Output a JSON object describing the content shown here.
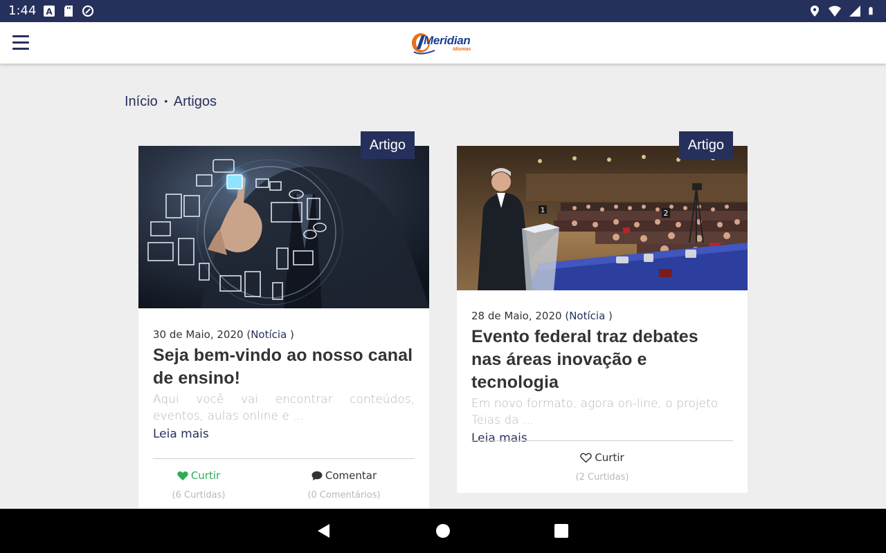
{
  "status_bar": {
    "time": "1:44",
    "left_icons": [
      "a-icon",
      "sd-card-icon",
      "sync-icon"
    ],
    "right_icons": [
      "location-icon",
      "wifi-icon",
      "signal-icon",
      "battery-icon"
    ]
  },
  "app_bar": {
    "menu_icon": "hamburger-menu-icon",
    "logo_text": "Meridian",
    "logo_subtext": "Idiomas"
  },
  "breadcrumb": {
    "home": "Início",
    "separator": "•",
    "current": "Artigos"
  },
  "colors": {
    "primary": "#26305c",
    "liked": "#2eac5a",
    "logo_orange": "#e9701d",
    "logo_blue": "#1d3f8f"
  },
  "cards": [
    {
      "tag": "Artigo",
      "date": "30 de Maio, 2020",
      "category_open": "(",
      "category": "Notícia",
      "category_close": ")",
      "title": "Seja bem-vindo ao nosso canal de ensino!",
      "excerpt": "Aqui você vai encontrar conteúdos, eventos, aulas online e ...",
      "read_more": "Leia mais",
      "like": {
        "label": "Curtir",
        "count": "(6 Curtidas)",
        "icon": "heart-filled-icon",
        "liked": true
      },
      "comment": {
        "label": "Comentar",
        "count": "(0 Comentários)",
        "icon": "comment-icon"
      }
    },
    {
      "tag": "Artigo",
      "date": "28 de Maio, 2020",
      "category_open": "(",
      "category": "Notícia",
      "category_close": ")",
      "title": "Evento federal traz debates nas áreas inovação e tecnologia",
      "excerpt": "Em novo formato, agora on-line, o projeto Teias da ...",
      "read_more": "Leia mais",
      "like": {
        "label": "Curtir",
        "count": "(2 Curtidas)",
        "icon": "heart-outline-icon",
        "liked": false
      }
    }
  ],
  "nav_bar": {
    "buttons": [
      "back-icon",
      "home-icon",
      "recents-icon"
    ]
  }
}
